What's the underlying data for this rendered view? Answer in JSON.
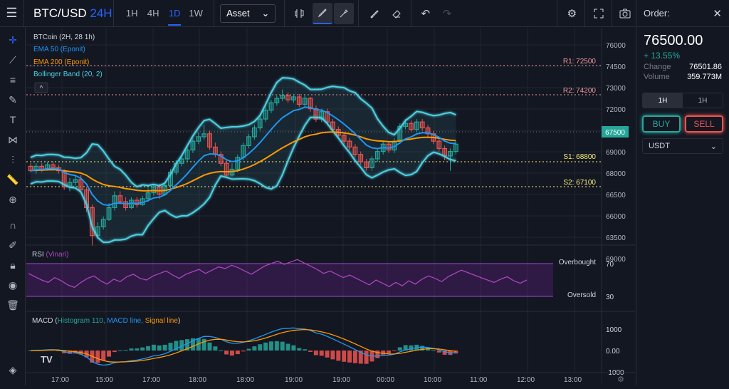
{
  "header": {
    "symbol": "BTC/USD",
    "period": "24H",
    "timeframes": [
      "1H",
      "4H",
      "1D",
      "1W"
    ],
    "active_timeframe": "1D",
    "asset_select": "Asset"
  },
  "legend": {
    "main": "BTCoin (2H, 28 1h)",
    "ema50": "EMA 50 (Eponit)",
    "ema200": "EMA 200 (Eponit)",
    "bb": "Bollinger Band (20, 2)"
  },
  "levels": {
    "r1": "R1: 72500",
    "r2": "R2: 74200",
    "s1": "S1: 68800",
    "s2": "S2: 67100",
    "current": "67500"
  },
  "price_axis": [
    "76000",
    "74500",
    "73000",
    "72000",
    "70500",
    "69000",
    "68000",
    "66500",
    "66000",
    "63500",
    "69000"
  ],
  "rsi": {
    "title": "RSI",
    "sub": "(Vinari)",
    "overbought": "Overbought",
    "oversold": "Oversold",
    "axis": [
      "70",
      "30"
    ]
  },
  "macd": {
    "title": "MACD",
    "hist": "Histogram 110,",
    "line": "MACD line,",
    "signal": "Signal line",
    "axis": [
      "1000",
      "0.00",
      "-1000"
    ]
  },
  "time_axis": [
    "17:00",
    "15:00",
    "17:00",
    "18:00",
    "18:00",
    "19:00",
    "19:00",
    "00:00",
    "10:00",
    "11:00",
    "12:00",
    "13:00"
  ],
  "order": {
    "title": "Order:",
    "price": "76500.00",
    "change_pct": "+ 13.55%",
    "change_label": "Change",
    "change_value": "76501.86",
    "volume_label": "Volume",
    "volume_value": "359.773M",
    "tabs": [
      "1H",
      "1H"
    ],
    "buy": "BUY",
    "sell": "SELL",
    "currency": "USDT"
  },
  "colors": {
    "up": "#26a69a",
    "down": "#ef5350",
    "ema50": "#2196f3",
    "ema200": "#ff9800",
    "bb": "#4dd0e1",
    "rsi": "#ab47bc",
    "accent": "#2962ff"
  },
  "chart_data": {
    "type": "candlestick",
    "series": "BTC/USD",
    "ylim": [
      62500,
      76500
    ],
    "candles": [
      [
        67600,
        67300,
        67800,
        67200
      ],
      [
        67300,
        67600,
        67800,
        67100
      ],
      [
        67600,
        67400,
        67800,
        67200
      ],
      [
        67400,
        67700,
        67900,
        67300
      ],
      [
        67700,
        67500,
        67900,
        67300
      ],
      [
        67500,
        67300,
        67700,
        67100
      ],
      [
        67300,
        66200,
        67400,
        66000
      ],
      [
        66200,
        66500,
        66800,
        65900
      ],
      [
        66500,
        66700,
        67000,
        66300
      ],
      [
        66700,
        66000,
        67000,
        65800
      ],
      [
        66000,
        64800,
        66200,
        64500
      ],
      [
        64800,
        62900,
        65000,
        62200
      ],
      [
        62900,
        63500,
        63800,
        62700
      ],
      [
        63500,
        64000,
        64200,
        63300
      ],
      [
        64000,
        64800,
        65100,
        63900
      ],
      [
        64800,
        65600,
        65900,
        64600
      ],
      [
        65600,
        65200,
        65900,
        65000
      ],
      [
        65200,
        64800,
        65500,
        64600
      ],
      [
        64800,
        65300,
        65500,
        64700
      ],
      [
        65300,
        65000,
        65500,
        64800
      ],
      [
        65000,
        65400,
        65600,
        64900
      ],
      [
        65400,
        65800,
        66100,
        65200
      ],
      [
        65800,
        66200,
        66400,
        65600
      ],
      [
        66200,
        65700,
        66400,
        65400
      ],
      [
        65700,
        66300,
        66500,
        65600
      ],
      [
        66300,
        67200,
        67400,
        66100
      ],
      [
        67200,
        67800,
        68000,
        67000
      ],
      [
        67800,
        68100,
        68300,
        67600
      ],
      [
        68100,
        68700,
        68900,
        67900
      ],
      [
        68700,
        69300,
        69500,
        68500
      ],
      [
        69300,
        69600,
        69900,
        69100
      ],
      [
        69600,
        69800,
        70400,
        69400
      ],
      [
        69800,
        68900,
        70000,
        68700
      ],
      [
        68900,
        68400,
        69200,
        68200
      ],
      [
        68400,
        67800,
        68600,
        67600
      ],
      [
        67800,
        67000,
        68000,
        66800
      ],
      [
        67000,
        67400,
        67800,
        66900
      ],
      [
        67400,
        68200,
        68400,
        67200
      ],
      [
        68200,
        69000,
        69200,
        68000
      ],
      [
        69000,
        69600,
        69800,
        68800
      ],
      [
        69600,
        70200,
        70400,
        69400
      ],
      [
        70200,
        70800,
        71000,
        70000
      ],
      [
        70800,
        71400,
        71600,
        70600
      ],
      [
        71400,
        71900,
        72100,
        71200
      ],
      [
        71900,
        72200,
        72400,
        71700
      ],
      [
        72200,
        72400,
        72800,
        72000
      ],
      [
        72400,
        72100,
        72600,
        71900
      ],
      [
        72100,
        72300,
        72500,
        71900
      ],
      [
        72300,
        71800,
        72500,
        71600
      ],
      [
        71800,
        72200,
        72400,
        71600
      ],
      [
        72200,
        71500,
        72300,
        71300
      ],
      [
        71500,
        70800,
        71700,
        70600
      ],
      [
        70800,
        71300,
        71500,
        70600
      ],
      [
        71300,
        70600,
        71500,
        70400
      ],
      [
        70600,
        70100,
        70800,
        69900
      ],
      [
        70100,
        69700,
        70300,
        69500
      ],
      [
        69700,
        69300,
        69900,
        69100
      ],
      [
        69300,
        68900,
        69500,
        68700
      ],
      [
        68900,
        68400,
        69100,
        68200
      ],
      [
        68400,
        67900,
        68600,
        67700
      ],
      [
        67900,
        67500,
        68100,
        67300
      ],
      [
        67500,
        68100,
        68300,
        67300
      ],
      [
        68100,
        68600,
        68800,
        67900
      ],
      [
        68600,
        69100,
        69300,
        68400
      ],
      [
        69100,
        68700,
        69300,
        68500
      ],
      [
        68700,
        69300,
        69500,
        68500
      ],
      [
        69300,
        70300,
        70500,
        69100
      ],
      [
        70300,
        70500,
        70800,
        70100
      ],
      [
        70500,
        70100,
        70700,
        69900
      ],
      [
        70100,
        70600,
        70800,
        69900
      ],
      [
        70600,
        70200,
        70800,
        70000
      ],
      [
        70200,
        69800,
        70400,
        69600
      ],
      [
        69800,
        69300,
        70000,
        69100
      ],
      [
        69300,
        68800,
        69500,
        68600
      ],
      [
        68800,
        68300,
        69000,
        68000
      ],
      [
        68300,
        68600,
        68800,
        67300
      ],
      [
        68600,
        69100,
        69300,
        68400
      ]
    ]
  },
  "rsi_data": [
    58,
    54,
    50,
    47,
    53,
    49,
    44,
    41,
    47,
    52,
    55,
    49,
    45,
    51,
    48,
    54,
    57,
    52,
    50,
    55,
    58,
    61,
    56,
    52,
    57,
    60,
    63,
    58,
    62,
    66,
    64,
    68,
    65,
    61,
    57,
    62,
    67,
    70,
    73,
    69,
    72,
    75,
    71,
    67,
    63,
    58,
    61,
    57,
    53,
    56,
    52,
    48,
    44,
    50,
    46,
    42,
    47,
    43,
    49,
    45,
    51,
    55,
    52,
    48,
    54,
    58,
    62,
    59,
    56,
    53,
    50,
    47,
    51,
    54,
    49,
    46,
    50
  ]
}
